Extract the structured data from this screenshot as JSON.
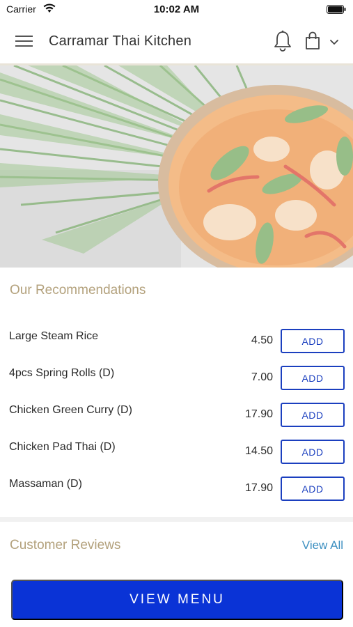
{
  "status_bar": {
    "carrier": "Carrier",
    "time": "10:02 AM"
  },
  "header": {
    "title": "Carramar Thai Kitchen",
    "icons": [
      "menu-icon",
      "bell-icon",
      "bag-icon",
      "chevron-down-icon"
    ]
  },
  "hero": {
    "image": "thai curry bowl on palm leaves"
  },
  "recommendations": {
    "title": "Our Recommendations",
    "add_label": "ADD",
    "items": [
      {
        "name": "Large Steam Rice",
        "price": "4.50"
      },
      {
        "name": "4pcs Spring Rolls (D)",
        "price": "7.00"
      },
      {
        "name": "Chicken Green Curry (D)",
        "price": "17.90"
      },
      {
        "name": "Chicken Pad Thai (D)",
        "price": "14.50"
      },
      {
        "name": "Massaman (D)",
        "price": "17.90"
      }
    ]
  },
  "reviews": {
    "title": "Customer Reviews",
    "view_all": "View All"
  },
  "cta": {
    "label": "VIEW MENU"
  },
  "colors": {
    "accent_blue": "#0a33d6",
    "outline_blue": "#1b3fbf",
    "section_title_gold": "#b3a17c",
    "link_blue": "#3b8fc0"
  }
}
